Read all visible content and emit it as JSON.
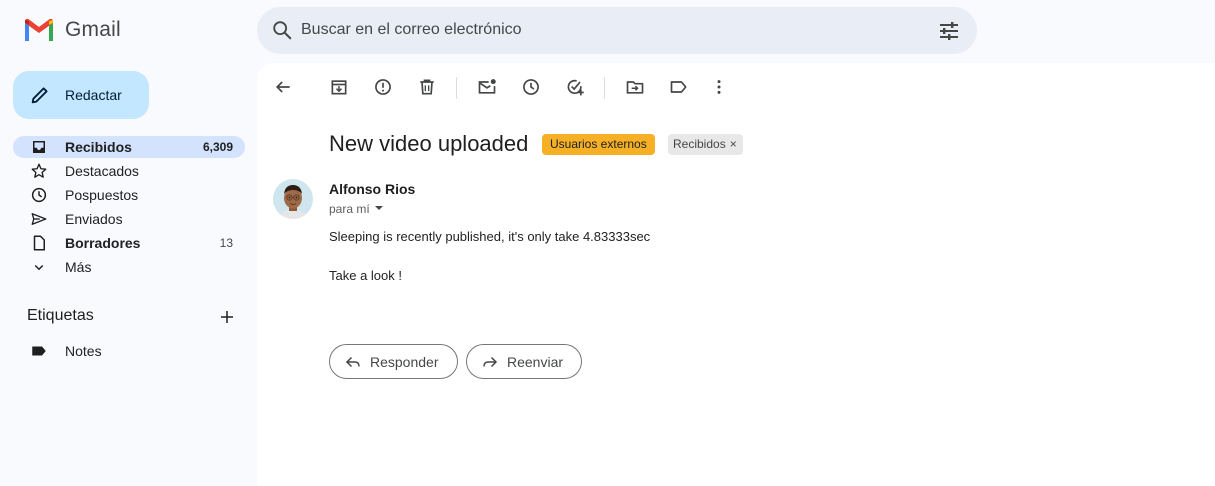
{
  "app": {
    "name": "Gmail"
  },
  "search": {
    "placeholder": "Buscar en el correo electrónico"
  },
  "compose": {
    "label": "Redactar"
  },
  "sidebar": {
    "items": [
      {
        "label": "Recibidos",
        "count": "6,309",
        "icon": "inbox-icon",
        "bold": true,
        "active": true
      },
      {
        "label": "Destacados",
        "count": "",
        "icon": "star-icon"
      },
      {
        "label": "Pospuestos",
        "count": "",
        "icon": "clock-icon"
      },
      {
        "label": "Enviados",
        "count": "",
        "icon": "send-icon"
      },
      {
        "label": "Borradores",
        "count": "13",
        "icon": "draft-icon",
        "bold": true
      },
      {
        "label": "Más",
        "count": "",
        "icon": "chevron-down-icon"
      }
    ],
    "labels_title": "Etiquetas",
    "labels": [
      {
        "label": "Notes",
        "icon": "label-icon"
      }
    ]
  },
  "toolbar": {
    "icons": [
      "back-icon",
      "archive-icon",
      "report-spam-icon",
      "delete-icon",
      "mark-unread-icon",
      "snooze-icon",
      "add-task-icon",
      "move-to-icon",
      "labels-icon",
      "more-icon"
    ]
  },
  "email": {
    "subject": "New video uploaded",
    "chips": {
      "external": "Usuarios externos",
      "inbox": "Recibidos",
      "inbox_close": "×"
    },
    "sender": "Alfonso Rios",
    "to": "para mí",
    "body": [
      "Sleeping is recently published, it's only take 4.83333sec",
      "Take a look !"
    ]
  },
  "actions": {
    "reply": "Responder",
    "forward": "Reenviar"
  },
  "colors": {
    "compose_bg": "#c2e7ff",
    "active_nav": "#d3e3fd",
    "search_bg": "#e9eef6",
    "external_chip": "#f6b026",
    "gmail_red": "#ea4335"
  }
}
